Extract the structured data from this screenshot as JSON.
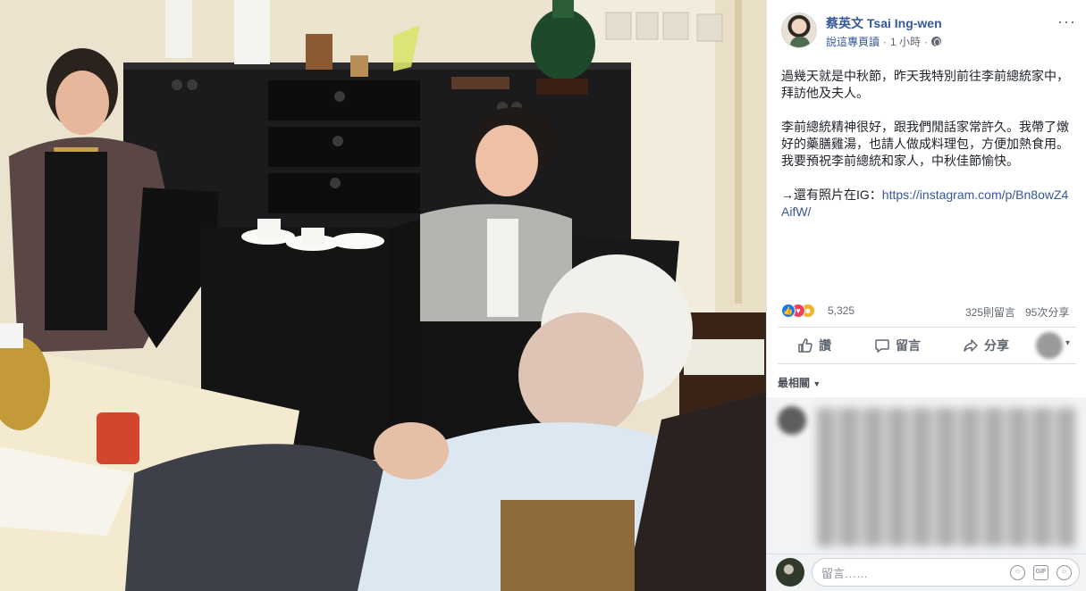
{
  "post": {
    "page_name": "蔡英文 Tsai Ing-wen",
    "meta_link": "說這專頁讀",
    "time": "1 小時",
    "separator": "·",
    "more": "···",
    "paragraphs": [
      "過幾天就是中秋節，昨天我特別前往李前總統家中，拜訪他及夫人。",
      "李前總統精神很好，跟我們閒話家常許久。我帶了燉好的藥膳雞湯，也請人做成料理包，方便加熱食用。我要預祝李前總統和家人，中秋佳節愉快。"
    ],
    "ig_prefix": "→還有照片在IG：",
    "ig_link": "https://instagram.com/p/Bn8owZ4AifW/"
  },
  "stats": {
    "reaction_count": "5,325",
    "comment_count": "325則留言",
    "share_count": "95次分享"
  },
  "actions": {
    "like": "讚",
    "comment": "留言",
    "share": "分享"
  },
  "sort": {
    "label": "最相關"
  },
  "comment_input": {
    "placeholder": "留言……"
  },
  "icons": {
    "like": "like-reaction-icon",
    "love": "love-reaction-icon",
    "haha": "haha-reaction-icon",
    "globe": "globe-icon",
    "emoji": "emoji-icon",
    "gif": "gif-icon",
    "sticker": "sticker-icon"
  },
  "colors": {
    "link": "#365899",
    "like_blue": "#1877f2",
    "love_red": "#f33e58",
    "haha_yellow": "#f7b125"
  }
}
